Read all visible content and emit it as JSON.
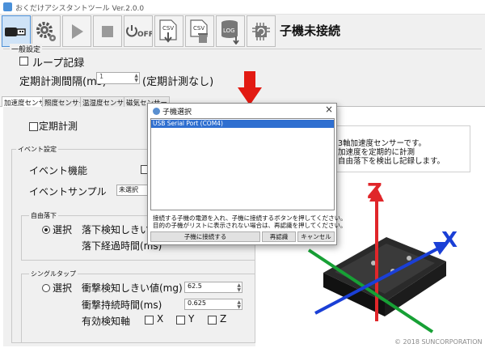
{
  "window": {
    "title": "おくだけアシスタントツール Ver.2.0.0"
  },
  "toolbar": {
    "buttons": [
      {
        "name": "connect",
        "icon": "usb-plug-icon"
      },
      {
        "name": "settings",
        "icon": "gear-icon"
      },
      {
        "name": "start",
        "icon": "play-icon"
      },
      {
        "name": "stop",
        "icon": "stop-icon"
      },
      {
        "name": "power-off",
        "icon": "power-off-icon",
        "label": "OFF"
      },
      {
        "name": "csv-download",
        "icon": "csv-download-icon",
        "label": "CSV"
      },
      {
        "name": "csv-delete",
        "icon": "csv-trash-icon",
        "label": "CSV"
      },
      {
        "name": "log-download",
        "icon": "log-database-icon",
        "label": "LOG"
      },
      {
        "name": "firmware",
        "icon": "chip-refresh-icon"
      }
    ],
    "status": "子機未接続"
  },
  "general": {
    "legend": "一般設定",
    "loop_label": "ループ記録",
    "interval_label": "定期計測間隔(ms)",
    "interval_value": "1",
    "interval_note": "(定期計測なし)"
  },
  "tabs": [
    "加速度センサー",
    "照度センサー",
    "温湿度センサー",
    "磁気センサー"
  ],
  "accel": {
    "periodic_label": "定期計測",
    "event_legend": "イベント設定",
    "event_function": "イベント機能",
    "event_sample": "イベントサンプル",
    "event_sample_value": "未選択",
    "fall": {
      "legend": "自由落下",
      "select_label": "選択",
      "threshold_label": "落下検知しきい値(mg)",
      "time_label": "落下経過時間(ms)"
    },
    "single": {
      "legend": "シングルタップ",
      "select_label": "選択",
      "shock_threshold_label": "衝撃検知しきい値(mg)",
      "shock_threshold_value": "62.5",
      "shock_time_label": "衝撃持続時間(ms)",
      "shock_time_value": "0.625",
      "valid_axis_label": "有効検知軸",
      "axes": [
        "X",
        "Y",
        "Z"
      ]
    },
    "description": [
      "3軸加速度センサーです。",
      "加速度を定期的に計測",
      "自由落下を検出し記録します。"
    ]
  },
  "diagram": {
    "axis_labels": {
      "x": "X",
      "z": "Z"
    },
    "colors": {
      "x": "#1a3fd6",
      "y": "#17a035",
      "z": "#e0262a"
    }
  },
  "copyright": "© 2018 SUNCORPORATION",
  "dialog": {
    "title": "子機選択",
    "close": "×",
    "devices": [
      "USB Serial Port (COM4)"
    ],
    "message_line1": "接続する子機の電源を入れ、子機に接続するボタンを押してください。",
    "message_line2": "目的の子機がリストに表示されない場合は、再認識を押してください。",
    "buttons": {
      "connect": "子機に接続する",
      "rescan": "再認識",
      "cancel": "キャンセル"
    }
  },
  "annotation": {
    "arrow_color": "#e21a12"
  }
}
